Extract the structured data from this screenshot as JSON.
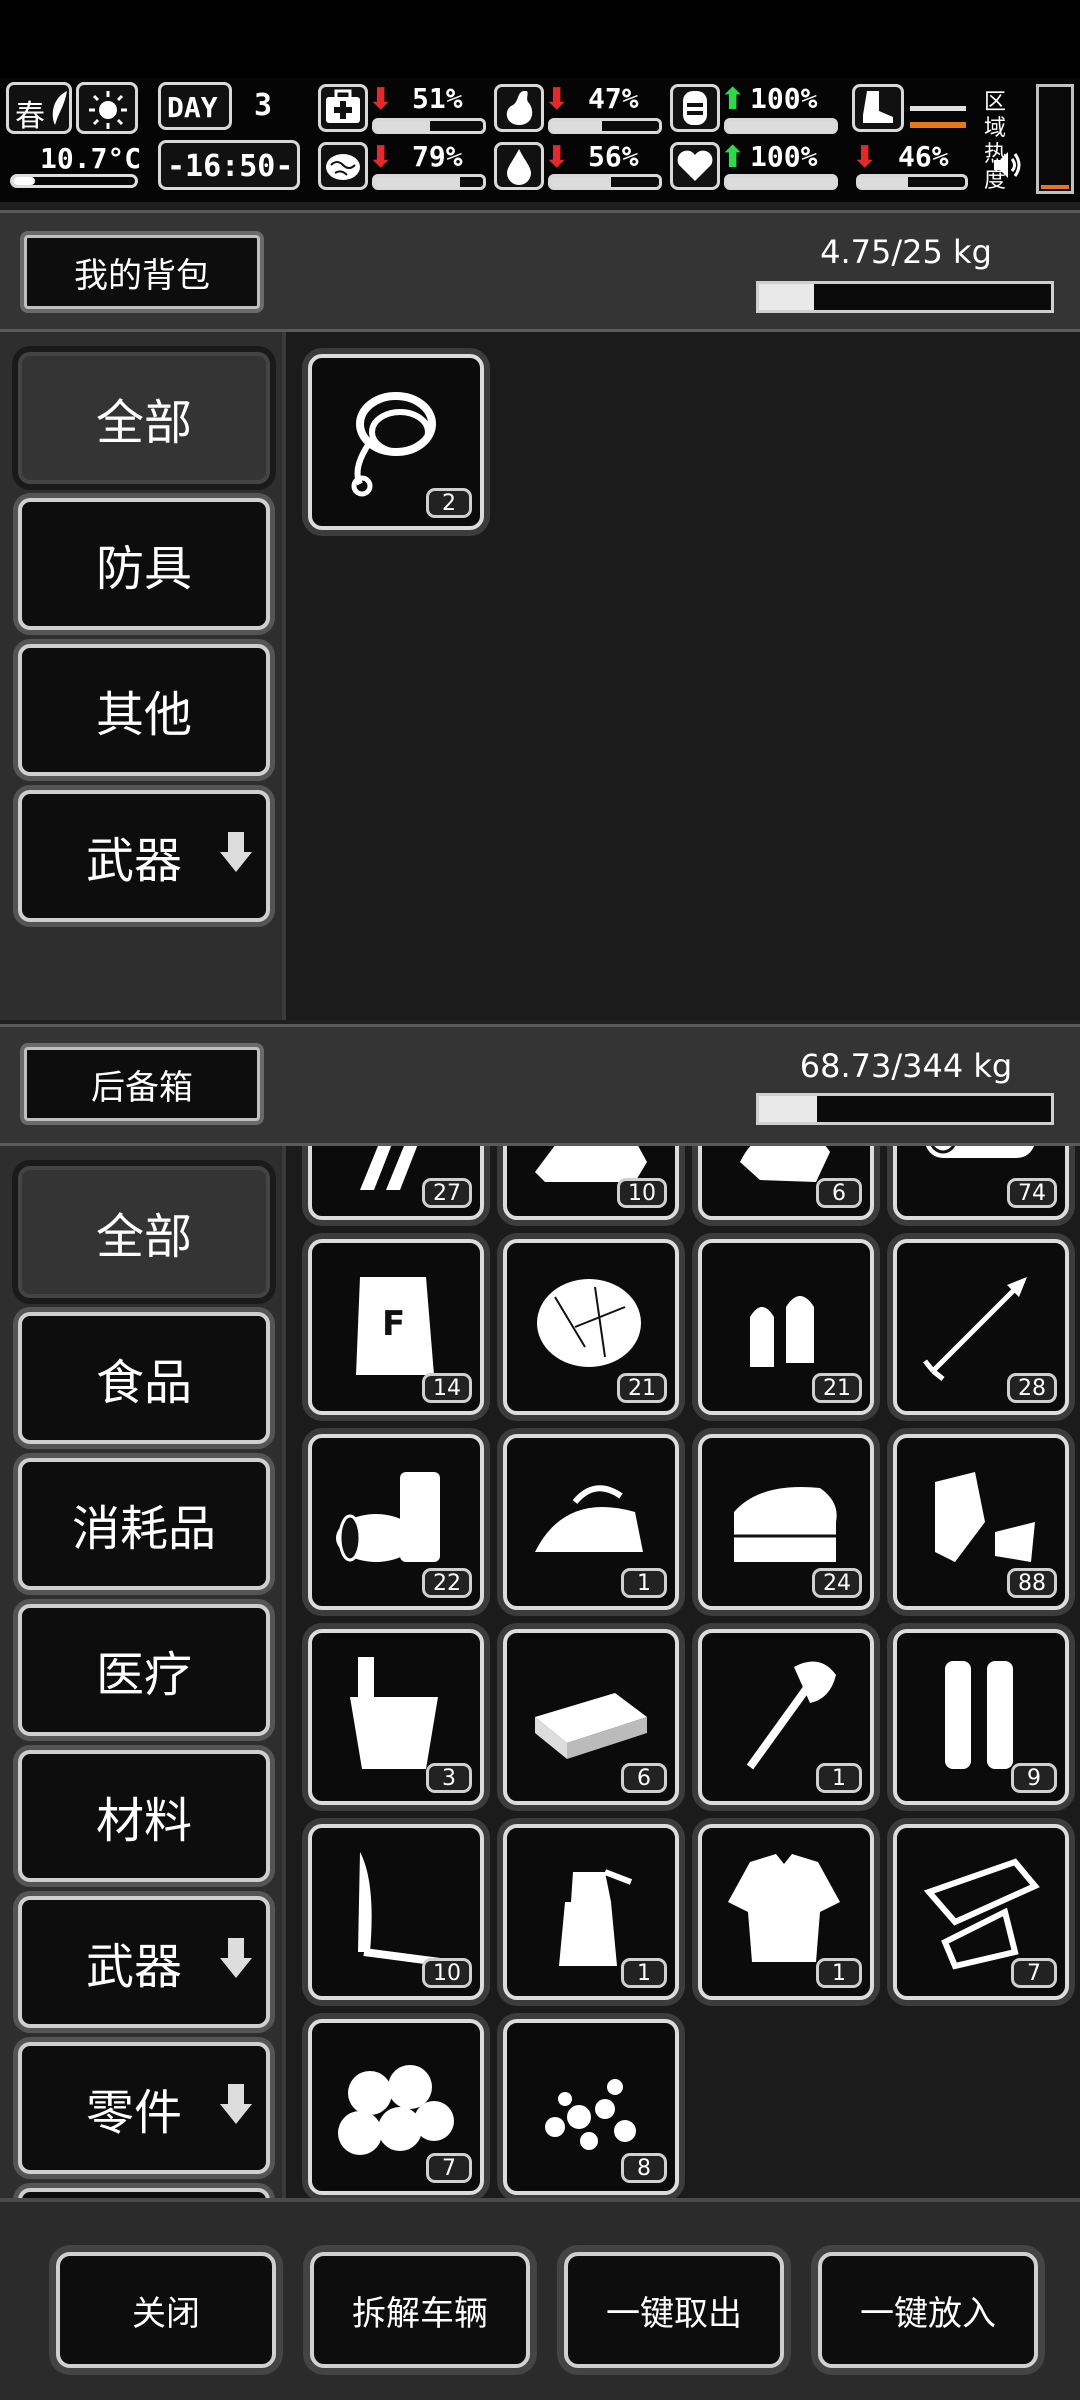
{
  "hud": {
    "season": "春",
    "temperature": "10.7°C",
    "day_label": "DAY",
    "day_number": "3",
    "time": "-16:50-",
    "stats": [
      {
        "name": "health",
        "value": "51%",
        "trend": "down",
        "level": 0.51
      },
      {
        "name": "stomach",
        "value": "47%",
        "trend": "down",
        "level": 0.47
      },
      {
        "name": "stamina",
        "value": "100%",
        "trend": "up",
        "level": 1.0
      },
      {
        "name": "brain",
        "value": "79%",
        "trend": "down",
        "level": 0.79
      },
      {
        "name": "thirst",
        "value": "56%",
        "trend": "down",
        "level": 0.56
      },
      {
        "name": "heart",
        "value": "100%",
        "trend": "up",
        "level": 1.0
      }
    ],
    "boot_value": "46%",
    "boot_level": 0.46,
    "zone_heat_label": "区域热度"
  },
  "backpack": {
    "title": "我的背包",
    "weight": "4.75/25 kg",
    "weight_fraction": 0.19,
    "categories": [
      {
        "label": "全部",
        "active": true
      },
      {
        "label": "防具"
      },
      {
        "label": "其他"
      },
      {
        "label": "武器",
        "expandable": true
      }
    ],
    "items": [
      {
        "icon": "rope-icon",
        "count": "2"
      }
    ]
  },
  "trunk": {
    "title": "后备箱",
    "weight": "68.73/344 kg",
    "weight_fraction": 0.2,
    "categories": [
      {
        "label": "全部",
        "active": true
      },
      {
        "label": "食品"
      },
      {
        "label": "消耗品"
      },
      {
        "label": "医疗"
      },
      {
        "label": "材料"
      },
      {
        "label": "武器",
        "expandable": true
      },
      {
        "label": "零件",
        "expandable": true
      }
    ],
    "items": [
      {
        "icon": "saw-blades-icon",
        "count": "27"
      },
      {
        "icon": "scrap-pile-icon",
        "count": "10"
      },
      {
        "icon": "cloth-scraps-icon",
        "count": "6"
      },
      {
        "icon": "logs-icon",
        "count": "74"
      },
      {
        "icon": "flour-bag-icon",
        "count": "14"
      },
      {
        "icon": "fiber-bundle-icon",
        "count": "21"
      },
      {
        "icon": "bullets-icon",
        "count": "21"
      },
      {
        "icon": "arrow-icon",
        "count": "28"
      },
      {
        "icon": "cans-icon",
        "count": "22"
      },
      {
        "icon": "iron-icon",
        "count": "1"
      },
      {
        "icon": "folded-cloth-icon",
        "count": "24"
      },
      {
        "icon": "leather-scraps-icon",
        "count": "88"
      },
      {
        "icon": "bucket-icon",
        "count": "3"
      },
      {
        "icon": "cash-stack-icon",
        "count": "6"
      },
      {
        "icon": "axe-icon",
        "count": "1"
      },
      {
        "icon": "shells-icon",
        "count": "9"
      },
      {
        "icon": "knife-icon",
        "count": "10"
      },
      {
        "icon": "spray-bottle-icon",
        "count": "1"
      },
      {
        "icon": "shirt-icon",
        "count": "1"
      },
      {
        "icon": "glass-shards-icon",
        "count": "7"
      },
      {
        "icon": "cotton-balls-icon",
        "count": "7"
      },
      {
        "icon": "stones-icon",
        "count": "8"
      }
    ]
  },
  "bottom_buttons": [
    {
      "label": "关闭",
      "name": "close-button"
    },
    {
      "label": "拆解车辆",
      "name": "dismantle-vehicle-button"
    },
    {
      "label": "一键取出",
      "name": "take-all-button"
    },
    {
      "label": "一键放入",
      "name": "put-all-button"
    }
  ]
}
